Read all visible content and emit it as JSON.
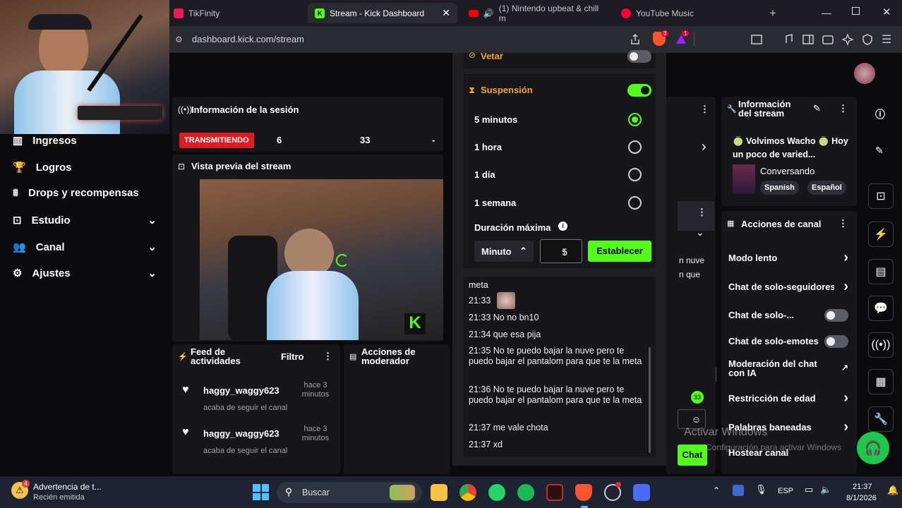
{
  "browser": {
    "tabs": [
      {
        "label": "TikFinity"
      },
      {
        "label": "Stream - Kick Dashboard"
      },
      {
        "label": "(1) Nintendo upbeat & chill m"
      },
      {
        "label": "YouTube Music"
      }
    ],
    "url": "dashboard.kick.com/stream",
    "shield_badge": "3",
    "alert_badge": "1"
  },
  "sidebar": {
    "items": [
      {
        "label": "Ingresos"
      },
      {
        "label": "Logros"
      },
      {
        "label": "Drops y recompensas"
      },
      {
        "label": "Estudio"
      },
      {
        "label": "Canal"
      },
      {
        "label": "Ajustes"
      }
    ]
  },
  "session": {
    "title": "Información de la sesión",
    "live_badge": "TRANSMITIENDO",
    "stat1": "6",
    "stat2": "33",
    "stat3": "-"
  },
  "preview": {
    "title": "Vista previa del stream"
  },
  "activity": {
    "title": "Feed de actividades",
    "filter": "Filtro",
    "items": [
      {
        "user": "haggy_waggy623",
        "action": "acaba de seguir el canal",
        "time": "hace 3 minutos"
      },
      {
        "user": "haggy_waggy623",
        "action": "acaba de seguir el canal",
        "time": "hace 3 minutos"
      }
    ]
  },
  "mod_actions": {
    "title": "Acciones de moderador"
  },
  "modal": {
    "vetar": "Vetar",
    "suspension": "Suspensión",
    "options": [
      "5 minutos",
      "1 hora",
      "1 día",
      "1 semana"
    ],
    "max_duration": "Duración máxima",
    "unit": "Minuto",
    "value": "5",
    "set_button": "Establecer"
  },
  "chat": {
    "lines": [
      {
        "text": "meta"
      },
      {
        "text": "21:33"
      },
      {
        "text": "21:33 No no bn10"
      },
      {
        "text": "21:34 que esa pija"
      },
      {
        "text": "21:35 No te puedo bajar la nuve pero te puedo bajar el pantalom para que te la meta"
      },
      {
        "text": "21:36 No te puedo bajar la nuve pero te puedo bajar el pantalom para que te la meta"
      },
      {
        "text": "21:37 me vale chota"
      },
      {
        "text": "21:37 xd"
      }
    ],
    "peek_text1": "n nuve",
    "peek_text2": "n que",
    "chat_button": "Chat",
    "badge_count": "33"
  },
  "stream_info": {
    "title": "Información del stream",
    "stream_title": "🍈 Volvimos Wacho 🍈 Hoy un poco de varied...",
    "category": "Conversando",
    "tags": [
      "Spanish",
      "Español"
    ]
  },
  "channel_actions": {
    "title": "Acciones de canal",
    "items": [
      {
        "label": "Modo lento",
        "control": "arrow"
      },
      {
        "label": "Chat de solo-seguidores",
        "control": "arrow"
      },
      {
        "label": "Chat de solo-...",
        "control": "toggle"
      },
      {
        "label": "Chat de solo-emotes",
        "control": "toggle"
      },
      {
        "label": "Moderación del chat con IA",
        "control": "external"
      },
      {
        "label": "Restricción de edad",
        "control": "arrow"
      },
      {
        "label": "Palabras baneadas",
        "control": "arrow"
      },
      {
        "label": "Hostear canal",
        "control": "none"
      }
    ]
  },
  "watermark": {
    "line1": "Activar Windows",
    "line2": "Configuración para activar Windows"
  },
  "taskbar": {
    "notification_title": "Advertencia de t...",
    "notification_sub": "Recién emitida",
    "notification_badge": "4",
    "search": "Buscar",
    "lang": "ESP",
    "time": "21:37",
    "date": "8/1/2026"
  },
  "colors": {
    "accent": "#53fc18",
    "live": "#e01b24",
    "warn": "#f5a623"
  }
}
